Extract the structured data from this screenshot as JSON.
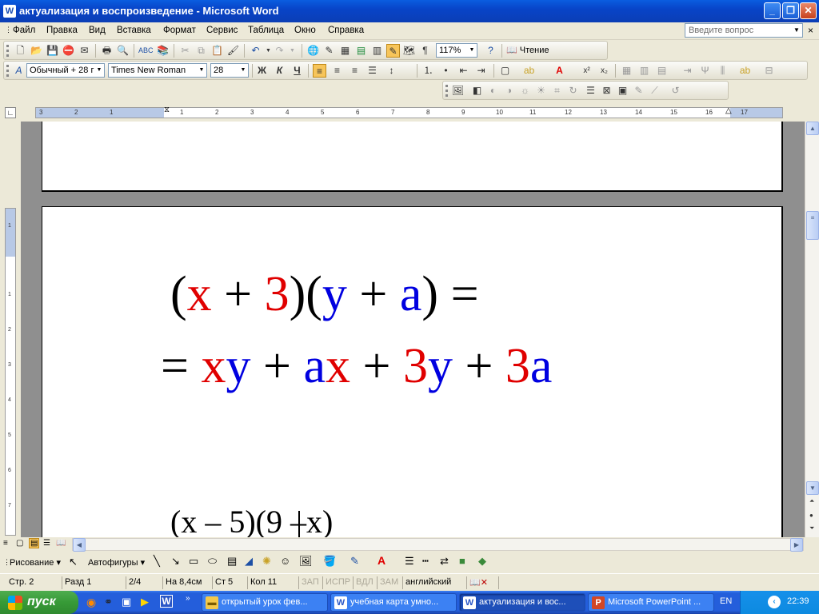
{
  "window": {
    "title": "актуализация и воспроизведение - Microsoft Word"
  },
  "menu": {
    "items": [
      "Файл",
      "Правка",
      "Вид",
      "Вставка",
      "Формат",
      "Сервис",
      "Таблица",
      "Окно",
      "Справка"
    ],
    "ask_placeholder": "Введите вопрос"
  },
  "toolbar_standard": {
    "zoom": "117%",
    "read_label": "Чтение"
  },
  "toolbar_format": {
    "style": "Обычный + 28 г",
    "font": "Times New Roman",
    "size": "28",
    "bold": "Ж",
    "italic": "К",
    "underline": "Ч"
  },
  "ruler": {
    "ticks": [
      "3",
      "2",
      "1",
      "1",
      "2",
      "3",
      "4",
      "5",
      "6",
      "7",
      "8",
      "9",
      "10",
      "11",
      "12",
      "13",
      "14",
      "15",
      "16",
      "17"
    ]
  },
  "vruler": {
    "ticks": [
      "1",
      "1",
      "2",
      "3",
      "4",
      "5",
      "6",
      "7"
    ]
  },
  "document": {
    "line1": {
      "parts": [
        {
          "t": "(",
          "c": "k"
        },
        {
          "t": "x",
          "c": "r"
        },
        {
          "t": " + ",
          "c": "k"
        },
        {
          "t": "3",
          "c": "r"
        },
        {
          "t": ")(",
          "c": "k"
        },
        {
          "t": "y",
          "c": "b"
        },
        {
          "t": " + ",
          "c": "k"
        },
        {
          "t": "a",
          "c": "b"
        },
        {
          "t": ") =",
          "c": "k"
        }
      ]
    },
    "line2": {
      "parts": [
        {
          "t": "= ",
          "c": "k"
        },
        {
          "t": "x",
          "c": "r"
        },
        {
          "t": "y",
          "c": "b"
        },
        {
          "t": " + ",
          "c": "k"
        },
        {
          "t": "a",
          "c": "b"
        },
        {
          "t": "x",
          "c": "r"
        },
        {
          "t": " + ",
          "c": "k"
        },
        {
          "t": "3",
          "c": "r"
        },
        {
          "t": "y",
          "c": "b"
        },
        {
          "t": " + ",
          "c": "k"
        },
        {
          "t": "3",
          "c": "r"
        },
        {
          "t": "a",
          "c": "b"
        }
      ]
    },
    "line3": "(x – 5)(9 –x)"
  },
  "drawbar": {
    "draw_label": "Рисование",
    "autoshapes_label": "Автофигуры"
  },
  "status": {
    "page": "Стр. 2",
    "section": "Разд 1",
    "pages": "2/4",
    "at": "На 8,4см",
    "line": "Ст 5",
    "col": "Кол 11",
    "rec": "ЗАП",
    "trk": "ИСПР",
    "ext": "ВДЛ",
    "ovr": "ЗАМ",
    "lang": "английский"
  },
  "taskbar": {
    "start": "пуск",
    "buttons": [
      "открытый урок фев...",
      "учебная карта умно...",
      "актуализация и вос...",
      "Microsoft PowerPoint ..."
    ],
    "lang": "EN",
    "time": "22:39"
  },
  "colors": {
    "red": "#e00000",
    "blue": "#0000e0",
    "title_blue": "#0a5de0"
  }
}
